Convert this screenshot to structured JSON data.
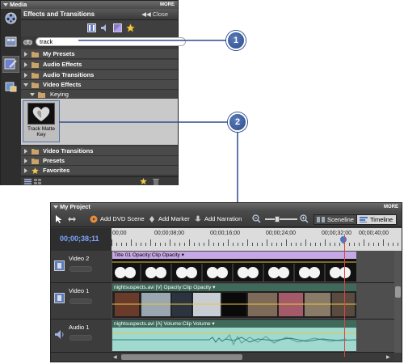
{
  "media_panel": {
    "title": "Media",
    "more_label": "MORE",
    "effects_title": "Effects and Transitions",
    "close_label": "Close",
    "search_value": "track",
    "tree": [
      {
        "label": "My Presets",
        "expanded": false
      },
      {
        "label": "Audio Effects",
        "expanded": false
      },
      {
        "label": "Audio Transitions",
        "expanded": false
      },
      {
        "label": "Video Effects",
        "expanded": true
      }
    ],
    "subfolder": "Keying",
    "effect_item": {
      "label_line1": "Track Matte",
      "label_line2": "Key"
    },
    "tree_after": [
      {
        "label": "Video Transitions"
      },
      {
        "label": "Presets"
      },
      {
        "label": "Favorites"
      }
    ]
  },
  "callouts": [
    {
      "number": "1"
    },
    {
      "number": "2"
    }
  ],
  "project_panel": {
    "title": "My Project",
    "more_label": "MORE",
    "toolbar": {
      "add_dvd_scene": "Add DVD Scene",
      "add_marker": "Add Marker",
      "add_narration": "Add Narration",
      "sceneline": "Sceneline",
      "timeline": "Timeline"
    },
    "timecode": "00;00;38;11",
    "ruler_labels": [
      "00;00",
      "00;00;08;00",
      "00;00;16;00",
      "00;00;24;00",
      "00;00;32;00",
      "00;00;40;00"
    ],
    "tracks": [
      {
        "name": "Video 2",
        "clip": "Title 01",
        "clip_prop": "Opacity:Clip Opacity"
      },
      {
        "name": "Video 1",
        "clip": "nightsuspects.avi [V]",
        "clip_prop": "Opacity:Clip Opacity"
      },
      {
        "name": "Audio 1",
        "clip": "nightsuspects.avi [A]",
        "clip_prop": "Volume:Clip Volume"
      }
    ]
  },
  "colors": {
    "callout": "#2d4c8c",
    "timecode": "#7ea6ff",
    "title_clip": "#b7a0d8",
    "video_clip": "#3f6a5a",
    "audio_clip": "#9fd9cf"
  }
}
